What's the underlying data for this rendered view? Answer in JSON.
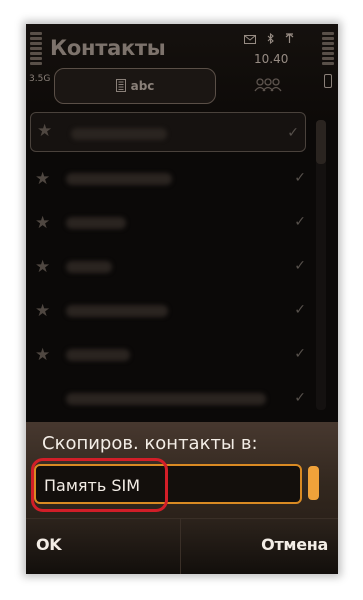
{
  "header": {
    "title": "Контакты",
    "clock": "10.40",
    "signal_label": "3.5G",
    "indicators": [
      "envelope-icon",
      "bluetooth-icon",
      "antenna-icon"
    ]
  },
  "tabs": [
    {
      "label": "abc",
      "icon": "contacts-book-icon",
      "selected": true
    },
    {
      "label": "",
      "icon": "groups-icon",
      "selected": false
    }
  ],
  "contacts": {
    "rows": [
      {
        "blurred": true,
        "checked": true,
        "selected": true
      },
      {
        "blurred": true,
        "checked": true
      },
      {
        "blurred": true,
        "checked": true
      },
      {
        "blurred": true,
        "checked": true
      },
      {
        "blurred": true,
        "checked": true
      },
      {
        "blurred": true,
        "checked": true
      },
      {
        "blurred": true,
        "checked": true
      }
    ]
  },
  "dialog": {
    "prompt": "Скопиров. контакты в:",
    "selected_value": "Память SIM"
  },
  "softkeys": {
    "left": "OK",
    "right": "Отмена"
  },
  "colors": {
    "accent": "#d98a23",
    "highlight": "#d21e28",
    "dialog_bg": "#3a2d24",
    "background": "#0b0908"
  }
}
